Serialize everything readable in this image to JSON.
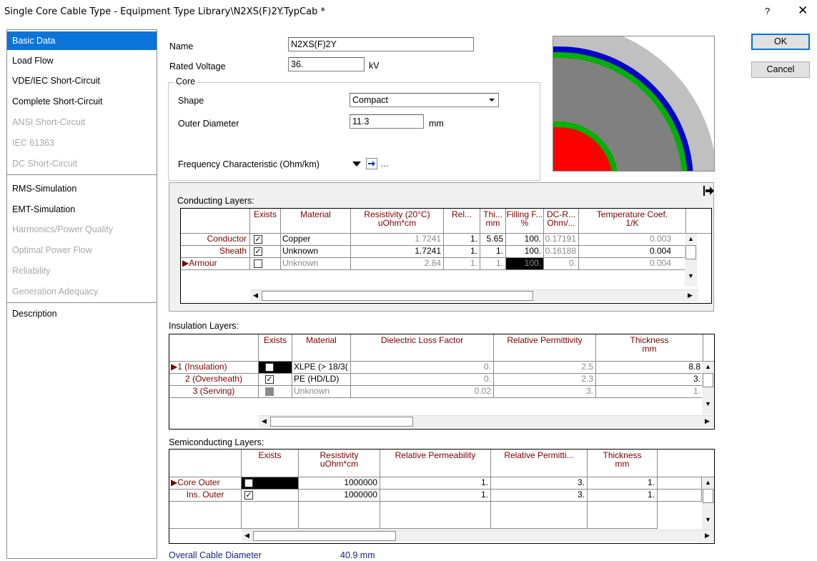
{
  "window": {
    "title": "Single Core Cable Type - Equipment Type Library\\N2XS(F)2Y.TypCab *",
    "help_label": "?",
    "close_label": "✕"
  },
  "sidebar": {
    "items": [
      {
        "label": "Basic Data",
        "state": "selected"
      },
      {
        "label": "Load Flow",
        "state": "enabled"
      },
      {
        "label": "VDE/IEC Short-Circuit",
        "state": "enabled"
      },
      {
        "label": "Complete Short-Circuit",
        "state": "enabled"
      },
      {
        "label": "ANSI Short-Circuit",
        "state": "disabled"
      },
      {
        "label": "IEC 61363",
        "state": "disabled"
      },
      {
        "label": "DC Short-Circuit",
        "state": "disabled"
      },
      {
        "label": "RMS-Simulation",
        "state": "enabled"
      },
      {
        "label": "EMT-Simulation",
        "state": "enabled"
      },
      {
        "label": "Harmonics/Power Quality",
        "state": "disabled"
      },
      {
        "label": "Optimal Power Flow",
        "state": "disabled"
      },
      {
        "label": "Reliability",
        "state": "disabled"
      },
      {
        "label": "Generation Adequacy",
        "state": "disabled"
      },
      {
        "label": "Description",
        "state": "enabled"
      }
    ]
  },
  "buttons": {
    "ok": "OK",
    "cancel": "Cancel"
  },
  "basic": {
    "name_label": "Name",
    "name_value": "N2XS(F)2Y",
    "rated_voltage_label": "Rated Voltage",
    "rated_voltage_value": "36.",
    "rated_voltage_unit": "kV",
    "core_group": "Core",
    "shape_label": "Shape",
    "shape_value": "Compact",
    "outer_diameter_label": "Outer Diameter",
    "outer_diameter_value": "11.3",
    "outer_diameter_unit": "mm",
    "freq_label": "Frequency Characteristic (Ohm/km)",
    "freq_more": "..."
  },
  "colors": {
    "selected": "#0a74da",
    "header_text": "#7a0000",
    "core": "#ff0000",
    "semicon": "#00b000",
    "insulation": "#808080",
    "sheath": "#0000c8",
    "serving": "#c0c0c0"
  },
  "conducting": {
    "title": "Conducting Layers:",
    "headers": [
      "Exists",
      "Material",
      "Resistivity (20°C)\nuOhm*cm",
      "Rel...",
      "Thi...\nmm",
      "Filling F...\n%",
      "DC-R...\nOhm/...",
      "Temperature Coef.\n1/K"
    ],
    "rows": [
      {
        "name": "Conductor",
        "exists": true,
        "material": "Copper",
        "resistivity": "1.7241",
        "rel": "1.",
        "thick": "5.65",
        "filling": "100.",
        "dcr": "0.17191",
        "temp": "0.003",
        "gray": false
      },
      {
        "name": "Sheath",
        "exists": true,
        "material": "Unknown",
        "resistivity": "1.7241",
        "rel": "1.",
        "thick": "1.",
        "filling": "100.",
        "dcr": "0.16188",
        "temp": "0.004",
        "gray": false
      },
      {
        "name": "Armour",
        "exists": false,
        "material": "Unknown",
        "resistivity": "2.84",
        "rel": "1.",
        "thick": "1.",
        "filling": "100.",
        "dcr": "0.",
        "temp": "0.004",
        "gray": true
      }
    ]
  },
  "insulation": {
    "title": "Insulation Layers:",
    "headers": [
      "Exists",
      "Material",
      "Dielectric Loss Factor",
      "Relative Permittivity",
      "Thickness\nmm"
    ],
    "rows": [
      {
        "name": "1 (Insulation)",
        "exists": true,
        "material": "XLPE (> 18/3(",
        "loss": "0.",
        "perm": "2.5",
        "thick": "8.8",
        "gray": false
      },
      {
        "name": "2 (Oversheath)",
        "exists": true,
        "material": "PE (HD/LD)",
        "loss": "0.",
        "perm": "2.3",
        "thick": "3.",
        "gray": false
      },
      {
        "name": "3 (Serving)",
        "exists": false,
        "material": "Unknown",
        "loss": "0.02",
        "perm": "3.",
        "thick": "1.",
        "gray": true
      }
    ]
  },
  "semiconducting": {
    "title": "Semiconducting Layers:",
    "headers": [
      "Exists",
      "Resistivity\nuOhm*cm",
      "Relative Permeability",
      "Relative Permitti...",
      "Thickness\nmm"
    ],
    "rows": [
      {
        "name": "Core Outer",
        "exists": true,
        "resistivity": "1000000",
        "perm": "1.",
        "permit": "3.",
        "thick": "1."
      },
      {
        "name": "Ins. Outer",
        "exists": true,
        "resistivity": "1000000",
        "perm": "1.",
        "permit": "3.",
        "thick": "1."
      }
    ]
  },
  "footer": {
    "overall_label": "Overall Cable Diameter",
    "overall_value": "40.9 mm"
  }
}
